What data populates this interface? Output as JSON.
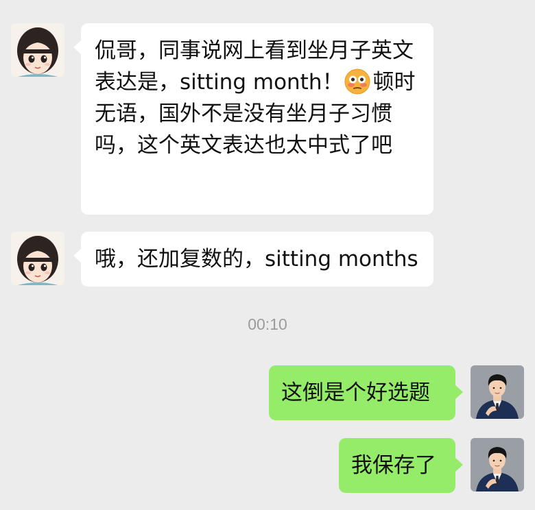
{
  "messages": [
    {
      "sender": "friend",
      "avatar_icon": "cartoon-girl-avatar-icon",
      "text_before_emoji": "侃哥，同事说网上看到坐月子英文表达是，sitting month！",
      "emoji": "flushed-face-emoji",
      "text_after_emoji": "顿时无语，国外不是没有坐月子习惯吗，这个英文表达也太中式了吧"
    },
    {
      "sender": "friend",
      "avatar_icon": "cartoon-girl-avatar-icon",
      "text": "哦，还加复数的，sitting months"
    },
    {
      "sender": "me",
      "avatar_icon": "man-in-suit-avatar-icon",
      "text": "这倒是个好选题"
    },
    {
      "sender": "me",
      "avatar_icon": "man-in-suit-avatar-icon",
      "text": "我保存了"
    }
  ],
  "timestamp": "00:10",
  "colors": {
    "background": "#ececec",
    "incoming_bubble": "#ffffff",
    "outgoing_bubble": "#95ec69",
    "timestamp_text": "#9b9b9b"
  }
}
